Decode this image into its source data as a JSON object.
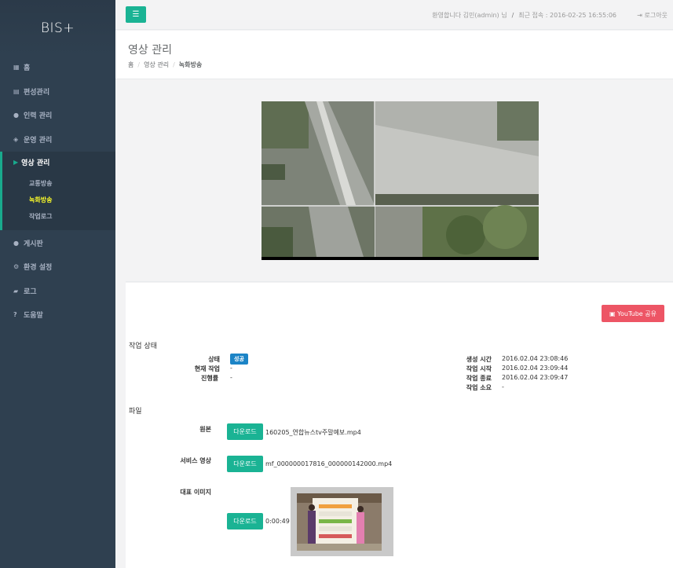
{
  "brand": "BIS+",
  "nav": {
    "home": "홈",
    "schedule": "편성관리",
    "staff": "인력 관리",
    "ops": "운영 관리",
    "video": "영상 관리",
    "sub": {
      "traffic": "교통방송",
      "recorded": "녹화방송",
      "worklog": "작업로그"
    },
    "board": "게시판",
    "settings": "환경 설정",
    "log": "로그",
    "help": "도움말"
  },
  "topbar": {
    "welcome": "환영합니다 김민(admin) 님",
    "last_login": "최근 접속 : 2016-02-25 16:55:06",
    "logout": "로그아웃"
  },
  "page": {
    "title": "영상 관리",
    "breadcrumb": [
      "홈",
      "영상 관리",
      "녹화방송"
    ]
  },
  "youtube_share": "YouTube 공유",
  "job": {
    "section_title": "작업 상태",
    "status_label": "상태",
    "status_value": "성공",
    "current_label": "현재 작업",
    "current_value": "-",
    "progress_label": "진행률",
    "progress_value": "-",
    "created_label": "생성 시간",
    "created_value": "2016.02.04 23:08:46",
    "start_label": "작업 시작",
    "start_value": "2016.02.04 23:09:44",
    "end_label": "작업 종료",
    "end_value": "2016.02.04 23:09:47",
    "duration_label": "작업 소요",
    "duration_value": "-"
  },
  "files": {
    "section_title": "파일",
    "original_label": "원본",
    "original_file": "160205_연합뉴스tv주말예보.mp4",
    "service_label": "서비스 영상",
    "service_file": "mf_000000017816_000000142000.mp4",
    "thumb_label": "대표 이미지",
    "thumb_time": "0:00:49",
    "download": "다운로드"
  },
  "colors": {
    "sidebar": "#2f4050",
    "primary": "#1ab394",
    "danger": "#ed5565",
    "info": "#1c84c6",
    "active_sub": "#f5f52a"
  }
}
